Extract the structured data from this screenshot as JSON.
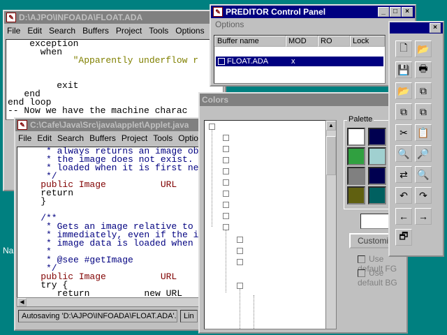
{
  "ada_window": {
    "title": "D:\\AJPO\\INFOADA\\FLOAT.ADA",
    "menu": [
      "File",
      "Edit",
      "Search",
      "Buffers",
      "Project",
      "Tools",
      "Options",
      "V"
    ],
    "code_lines": [
      {
        "t": "    exception",
        "c": "kw"
      },
      {
        "t": "      when",
        "c": "kw"
      },
      {
        "t": "            \"Apparently underflow r",
        "c": "str"
      },
      {
        "t": "",
        "c": "kw"
      },
      {
        "t": "",
        "c": "kw"
      },
      {
        "t": "         exit",
        "c": "kw"
      },
      {
        "t": "   end",
        "c": "kw"
      },
      {
        "t": "end loop",
        "c": "kw"
      },
      {
        "t": "-- Now we have the machine charac",
        "c": "kw"
      }
    ]
  },
  "java_window": {
    "title": "C:\\Cafe\\Java\\Src\\java\\applet\\Applet.java",
    "menu": [
      "File",
      "Edit",
      "Search",
      "Buffers",
      "Project",
      "Tools",
      "Optio"
    ],
    "code_lines": [
      {
        "t": "     * always returns an image ob",
        "c": "cmt"
      },
      {
        "t": "     * the image does not exist.",
        "c": "cmt"
      },
      {
        "t": "     * loaded when it is first ne",
        "c": "cmt"
      },
      {
        "t": "     */",
        "c": "cmt"
      },
      {
        "t": "    public Image          URL",
        "c": "typ"
      },
      {
        "t": "    return",
        "c": "kw"
      },
      {
        "t": "    }",
        "c": "kw"
      },
      {
        "t": "",
        "c": "kw"
      },
      {
        "t": "    /**",
        "c": "cmt"
      },
      {
        "t": "     * Gets an image relative to",
        "c": "cmt"
      },
      {
        "t": "     * immediately, even if the i",
        "c": "cmt"
      },
      {
        "t": "     * image data is loaded when",
        "c": "cmt"
      },
      {
        "t": "     *",
        "c": "cmt"
      },
      {
        "t": "     * @see #getImage",
        "c": "cmt"
      },
      {
        "t": "     */",
        "c": "cmt"
      },
      {
        "t": "    public Image          URL",
        "c": "typ"
      },
      {
        "t": "    try {",
        "c": "kw"
      },
      {
        "t": "       return          new URL",
        "c": "kw"
      }
    ]
  },
  "status": {
    "message": "Autosaving 'D:\\AJPO\\INFOADA\\FLOAT.ADA'.",
    "line": "Lin"
  },
  "control_panel": {
    "title": "PREDITOR Control Panel",
    "options_label": "Options",
    "columns": [
      "Buffer name",
      "MOD",
      "RO",
      "Lock"
    ],
    "row": {
      "name": "FLOAT.ADA",
      "mod": "x"
    }
  },
  "colors_window": {
    "title": "Colors",
    "palette_label": "Palette",
    "customize_label": "Customize",
    "use_default_fg": "Use default FG",
    "use_default_bg": "Use default BG",
    "swatches": [
      "#ffffff",
      "#000050",
      "#30a040",
      "#a0d0d0",
      "#808080",
      "#000050",
      "#606010",
      "#006060"
    ]
  },
  "desktop_label": "Na"
}
